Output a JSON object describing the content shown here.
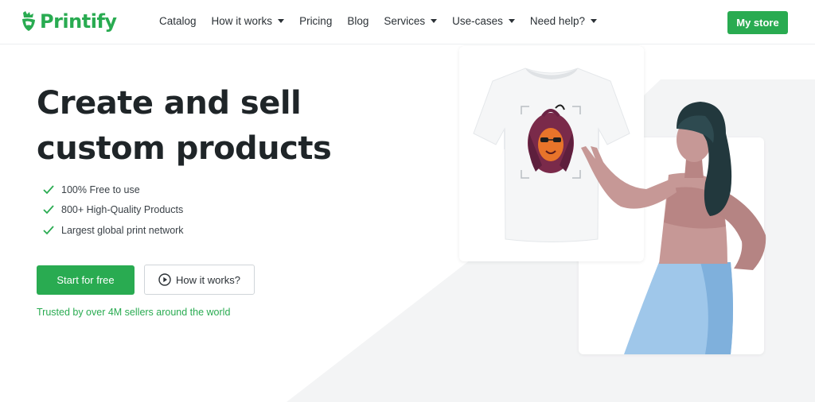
{
  "header": {
    "logo_text": "Printify",
    "nav": [
      {
        "label": "Catalog",
        "has_dropdown": false
      },
      {
        "label": "How it works",
        "has_dropdown": true
      },
      {
        "label": "Pricing",
        "has_dropdown": false
      },
      {
        "label": "Blog",
        "has_dropdown": false
      },
      {
        "label": "Services",
        "has_dropdown": true
      },
      {
        "label": "Use-cases",
        "has_dropdown": true
      },
      {
        "label": "Need help?",
        "has_dropdown": true
      }
    ],
    "my_store_label": "My store"
  },
  "hero": {
    "title_line1": "Create and sell",
    "title_line2": "custom products",
    "features": [
      "100% Free to use",
      "800+ High-Quality Products",
      "Largest global print network"
    ],
    "start_button": "Start for free",
    "how_button": "How it works?",
    "trusted_text": "Trusted by over 4M sellers around the world"
  },
  "colors": {
    "brand_green": "#29ab51",
    "text_dark": "#1f2528",
    "skirt_blue": "#9fc7ea",
    "hair_dark": "#22383d",
    "skin": "#c69896"
  },
  "icons": {
    "logo": "printify-logo-icon",
    "check": "check-icon",
    "play": "play-circle-icon",
    "caret": "chevron-down-icon"
  }
}
